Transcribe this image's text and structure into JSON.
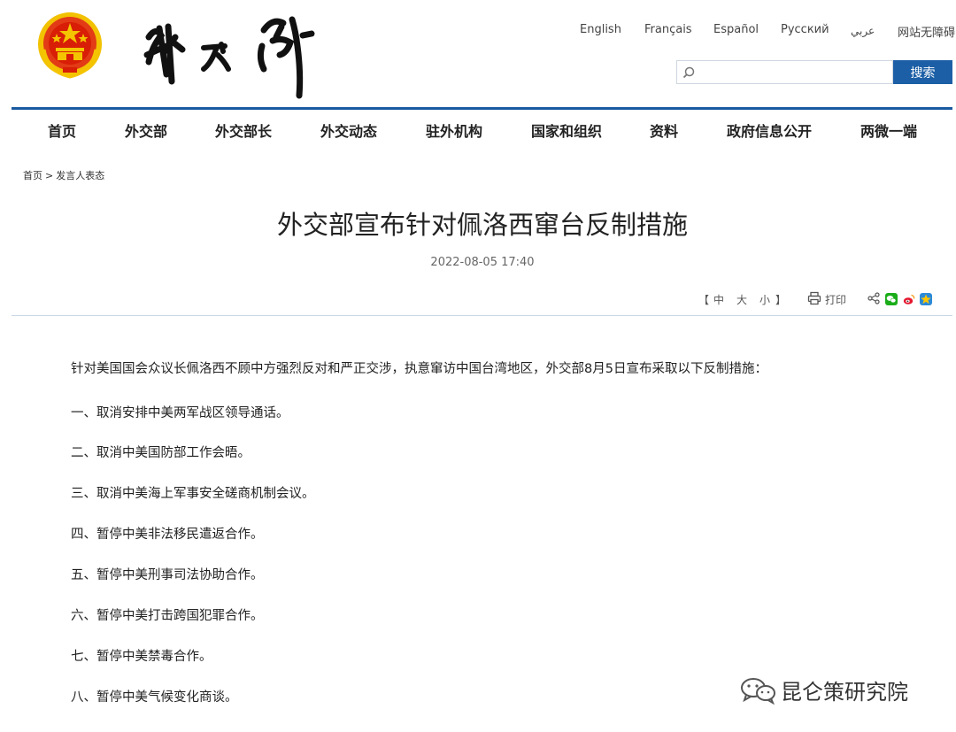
{
  "header": {
    "emblem_name": "national-emblem",
    "logo_name": "ministry-calligraphy-logo",
    "languages": [
      "English",
      "Français",
      "Español",
      "Русский",
      "عربي",
      "网站无障碍"
    ],
    "search": {
      "placeholder": "",
      "button_label": "搜索",
      "icon": "search-icon"
    }
  },
  "nav": {
    "items": [
      "首页",
      "外交部",
      "外交部长",
      "外交动态",
      "驻外机构",
      "国家和组织",
      "资料",
      "政府信息公开",
      "两微一端"
    ]
  },
  "breadcrumb": {
    "items": [
      "首页",
      "发言人表态"
    ],
    "separator": ">"
  },
  "article": {
    "title": "外交部宣布针对佩洛西窜台反制措施",
    "date": "2022-08-05 17:40",
    "font_tools": {
      "open": "【",
      "sizes": [
        "中",
        "大",
        "小"
      ],
      "close": "】"
    },
    "print_label": "打印",
    "paragraphs": [
      "针对美国国会众议长佩洛西不顾中方强烈反对和严正交涉，执意窜访中国台湾地区，外交部8月5日宣布采取以下反制措施：",
      "一、取消安排中美两军战区领导通话。",
      "二、取消中美国防部工作会晤。",
      "三、取消中美海上军事安全磋商机制会议。",
      "四、暂停中美非法移民遣返合作。",
      "五、暂停中美刑事司法协助合作。",
      "六、暂停中美打击跨国犯罪合作。",
      "七、暂停中美禁毒合作。",
      "八、暂停中美气候变化商谈。"
    ]
  },
  "share_icons": [
    "share-icon",
    "wechat-icon",
    "weibo-icon",
    "qzone-icon"
  ],
  "watermark": {
    "text": "昆仑策研究院",
    "icon": "wechat-watermark-icon"
  },
  "colors": {
    "primary_blue": "#1c5fa6",
    "rule_blue": "#1a5aa0",
    "emblem_red": "#d81e06",
    "emblem_gold": "#f5c400"
  }
}
